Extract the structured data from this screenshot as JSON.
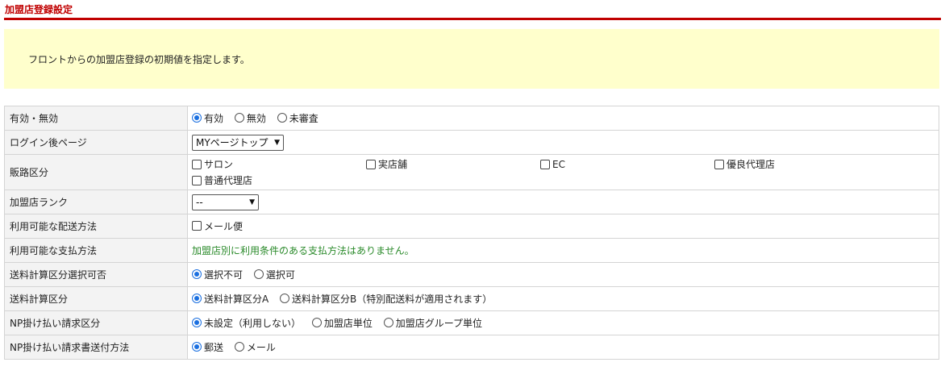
{
  "page": {
    "title": "加盟店登録設定"
  },
  "notice": {
    "text": "フロントからの加盟店登録の初期値を指定します。"
  },
  "rows": {
    "status": {
      "label": "有効・無効",
      "options": [
        {
          "label": "有効",
          "checked": true
        },
        {
          "label": "無効",
          "checked": false
        },
        {
          "label": "未審査",
          "checked": false
        }
      ]
    },
    "after_login": {
      "label": "ログイン後ページ",
      "selected": "MYページトップ"
    },
    "channel": {
      "label": "販路区分",
      "options": [
        {
          "label": "サロン"
        },
        {
          "label": "実店舗"
        },
        {
          "label": "EC"
        },
        {
          "label": "優良代理店"
        },
        {
          "label": "普通代理店"
        }
      ]
    },
    "rank": {
      "label": "加盟店ランク",
      "selected": "--"
    },
    "delivery": {
      "label": "利用可能な配送方法",
      "options": [
        {
          "label": "メール便"
        }
      ]
    },
    "payment": {
      "label": "利用可能な支払方法",
      "message": "加盟店別に利用条件のある支払方法はありません。"
    },
    "shipping_select": {
      "label": "送料計算区分選択可否",
      "options": [
        {
          "label": "選択不可",
          "checked": true
        },
        {
          "label": "選択可",
          "checked": false
        }
      ]
    },
    "shipping_type": {
      "label": "送料計算区分",
      "options": [
        {
          "label": "送料計算区分A",
          "checked": true
        },
        {
          "label": "送料計算区分B（特別配送料が適用されます）",
          "checked": false
        }
      ]
    },
    "np_billing": {
      "label": "NP掛け払い請求区分",
      "options": [
        {
          "label": "未設定（利用しない）",
          "checked": true
        },
        {
          "label": "加盟店単位",
          "checked": false
        },
        {
          "label": "加盟店グループ単位",
          "checked": false
        }
      ]
    },
    "np_send": {
      "label": "NP掛け払い請求書送付方法",
      "options": [
        {
          "label": "郵送",
          "checked": true
        },
        {
          "label": "メール",
          "checked": false
        }
      ]
    }
  }
}
